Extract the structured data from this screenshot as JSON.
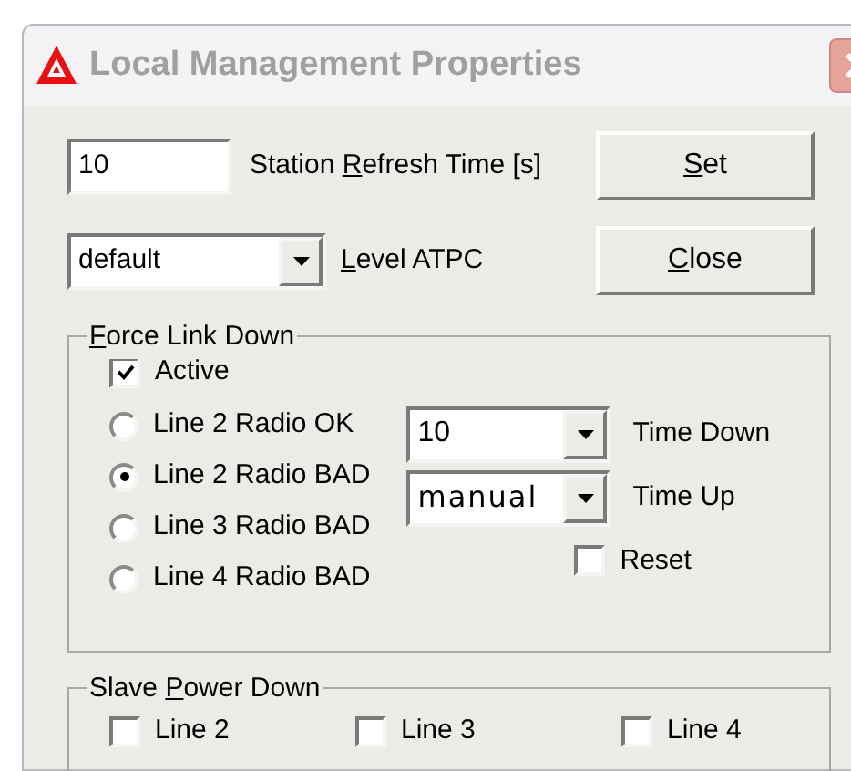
{
  "window": {
    "title": "Local Management Properties",
    "active": false
  },
  "refresh": {
    "value": "10",
    "label": {
      "before": "Station ",
      "key": "R",
      "after": "efresh Time [s]"
    }
  },
  "atpc": {
    "value": "default",
    "label": {
      "key": "L",
      "after": "evel ATPC"
    }
  },
  "buttons": [
    {
      "label": {
        "key": "S",
        "after": "et"
      }
    },
    {
      "label": {
        "key": "C",
        "after": "lose"
      }
    }
  ],
  "force_link_down": {
    "legend": {
      "key": "F",
      "after": "orce Link Down"
    },
    "active": {
      "label": "Active",
      "checked": true
    },
    "options": [
      {
        "label": "Line 2 Radio OK",
        "selected": false
      },
      {
        "label": "Line 2 Radio BAD",
        "selected": true
      },
      {
        "label": "Line 3 Radio BAD",
        "selected": false
      },
      {
        "label": "Line 4 Radio BAD",
        "selected": false
      }
    ],
    "time_down": {
      "value": "10",
      "label": "Time Down"
    },
    "time_up": {
      "value": "manual",
      "label": "Time Up"
    },
    "reset": {
      "label": "Reset",
      "checked": false
    }
  },
  "slave_power_down": {
    "legend": {
      "before": "Slave ",
      "key": "P",
      "after": "ower Down"
    },
    "lines": [
      {
        "label": "Line 2",
        "checked": false
      },
      {
        "label": "Line 3",
        "checked": false
      },
      {
        "label": "Line 4",
        "checked": false
      }
    ]
  }
}
